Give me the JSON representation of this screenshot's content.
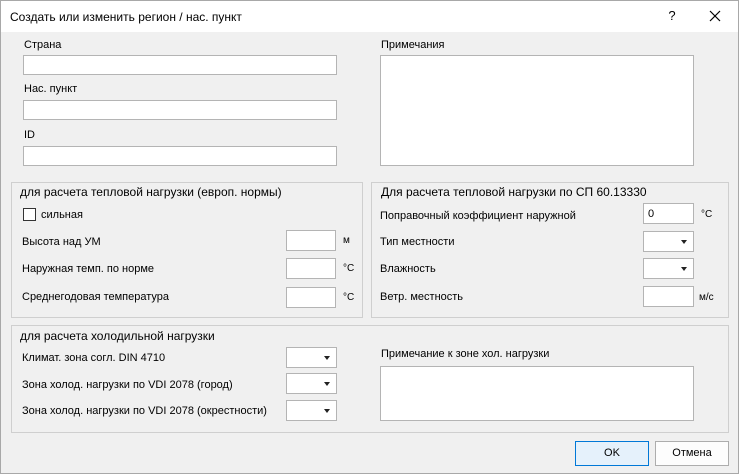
{
  "window": {
    "title": "Создать или изменить регион / нас. пункт",
    "help_glyph": "?"
  },
  "location": {
    "country_label": "Страна",
    "country_value": "",
    "settlement_label": "Нас. пункт",
    "settlement_value": "",
    "id_label": "ID",
    "id_value": "",
    "notes_label": "Примечания",
    "notes_value": ""
  },
  "heat_eu": {
    "title": "для расчета тепловой нагрузки (европ. нормы)",
    "strong_label": "сильная",
    "strong_checked": false,
    "altitude_label": "Высота над УМ",
    "altitude_value": "",
    "altitude_unit": "м",
    "outdoor_temp_label": "Наружная темп. по норме",
    "outdoor_temp_value": "",
    "outdoor_temp_unit": "°C",
    "annual_temp_label": "Среднегодовая температура",
    "annual_temp_value": "",
    "annual_temp_unit": "°C"
  },
  "heat_sp": {
    "title": "Для расчета тепловой нагрузки по СП 60.13330",
    "correction_label": "Поправочный коэффициент наружной",
    "correction_value": "0",
    "correction_unit": "°C",
    "terrain_label": "Тип местности",
    "terrain_value": "",
    "humidity_label": "Влажность",
    "humidity_value": "",
    "wind_label": "Ветр. местность",
    "wind_value": "",
    "wind_unit": "м/с"
  },
  "cooling": {
    "title": "для расчета холодильной нагрузки",
    "climate_zone_label": "Климат. зона согл. DIN 4710",
    "climate_zone_value": "",
    "vdi_city_label": "Зона холод. нагрузки по VDI 2078 (город)",
    "vdi_city_value": "",
    "vdi_surround_label": "Зона холод. нагрузки по VDI 2078 (окрестности)",
    "vdi_surround_value": "",
    "note_label": "Примечание к зоне хол. нагрузки",
    "note_value": ""
  },
  "buttons": {
    "ok": "OK",
    "cancel": "Отмена"
  },
  "icons": {
    "close": "close-icon",
    "dropdown": "chevron-down-icon"
  },
  "colors": {
    "accent": "#0078d7"
  }
}
